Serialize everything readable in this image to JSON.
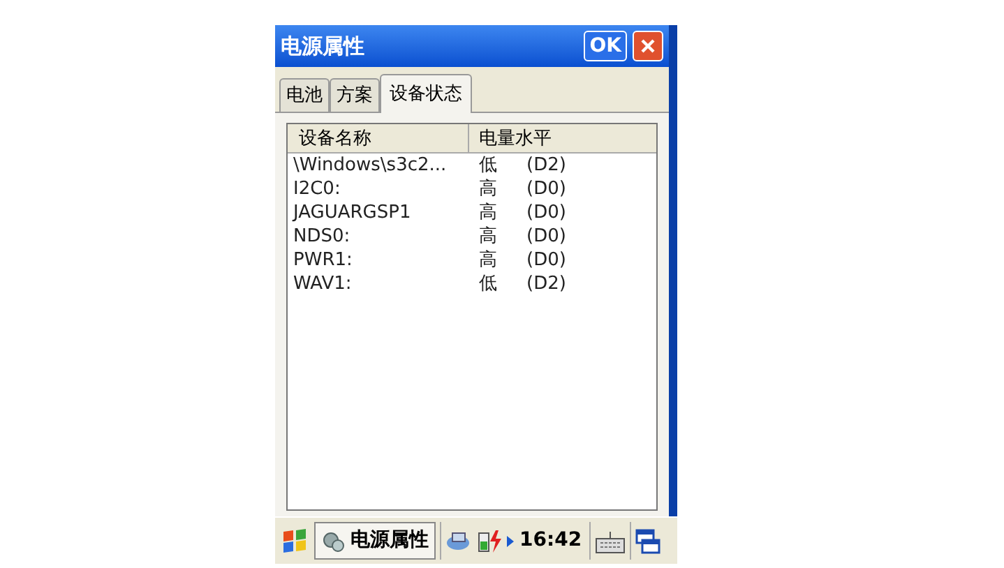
{
  "window": {
    "title": "电源属性",
    "ok_button": "OK"
  },
  "tabs": [
    {
      "label": "电池",
      "selected": false
    },
    {
      "label": "方案",
      "selected": false
    },
    {
      "label": "设备状态",
      "selected": true
    }
  ],
  "table": {
    "columns": [
      "设备名称",
      "电量水平"
    ],
    "rows": [
      {
        "name": "\\Windows\\s3c2...",
        "level": "低",
        "state": "(D2)"
      },
      {
        "name": "I2C0:",
        "level": "高",
        "state": "(D0)"
      },
      {
        "name": "JAGUARGSP1",
        "level": "高",
        "state": "(D0)"
      },
      {
        "name": "NDS0:",
        "level": "高",
        "state": "(D0)"
      },
      {
        "name": "PWR1:",
        "level": "高",
        "state": "(D0)"
      },
      {
        "name": "WAV1:",
        "level": "低",
        "state": "(D2)"
      }
    ]
  },
  "taskbar": {
    "task": "电源属性",
    "time": "16:42"
  }
}
